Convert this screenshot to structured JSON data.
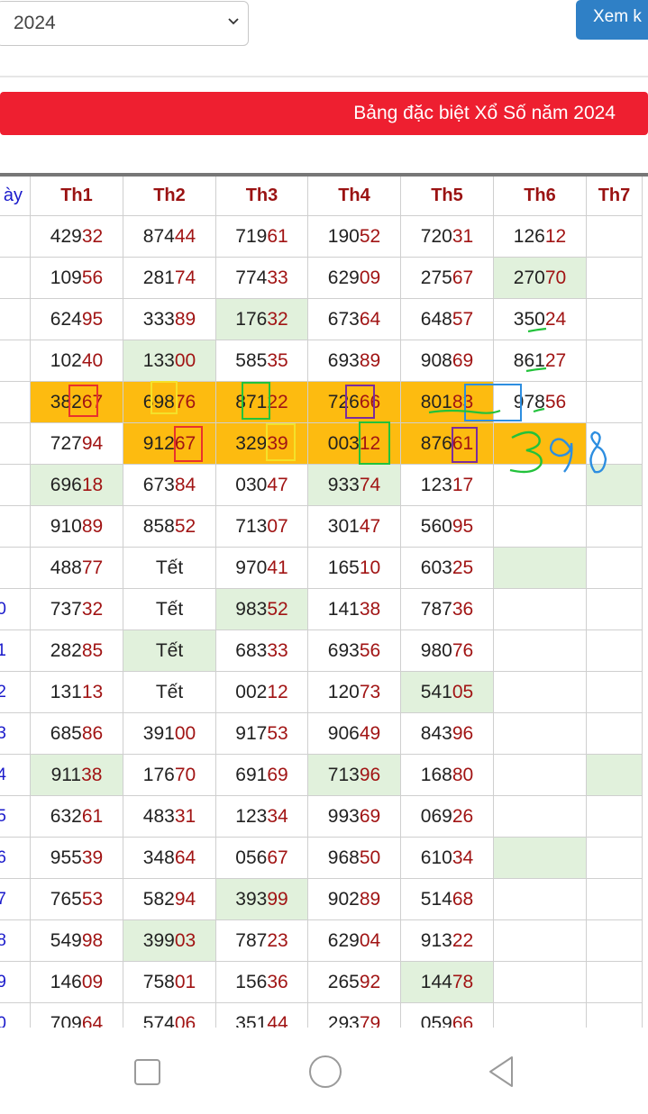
{
  "controls": {
    "year_value": "2024",
    "view_button": "Xem k"
  },
  "banner": {
    "title": "Bảng đặc biệt Xổ Số năm 2024"
  },
  "table": {
    "headers": [
      "ày",
      "Th1",
      "Th2",
      "Th3",
      "Th4",
      "Th5",
      "Th6",
      "Th7"
    ],
    "rows": [
      {
        "day": "",
        "cells": [
          "42932",
          "87444",
          "71961",
          "19052",
          "72031",
          "12612",
          ""
        ]
      },
      {
        "day": "",
        "cells": [
          "10956",
          "28174",
          "77433",
          "62909",
          "27567",
          "27070",
          ""
        ]
      },
      {
        "day": "",
        "cells": [
          "62495",
          "33389",
          "17632",
          "67364",
          "64857",
          "35024",
          ""
        ]
      },
      {
        "day": "",
        "cells": [
          "10240",
          "13300",
          "58535",
          "69389",
          "90869",
          "86127",
          ""
        ]
      },
      {
        "day": "",
        "cells": [
          "38267",
          "69876",
          "87122",
          "72666",
          "80183",
          "97856",
          ""
        ]
      },
      {
        "day": "",
        "cells": [
          "72794",
          "91267",
          "32939",
          "00312",
          "87661",
          "",
          ""
        ]
      },
      {
        "day": "",
        "cells": [
          "69618",
          "67384",
          "03047",
          "93374",
          "12317",
          "",
          ""
        ]
      },
      {
        "day": "",
        "cells": [
          "91089",
          "85852",
          "71307",
          "30147",
          "56095",
          "",
          ""
        ]
      },
      {
        "day": "",
        "cells": [
          "48877",
          "Tết",
          "97041",
          "16510",
          "60325",
          "",
          ""
        ]
      },
      {
        "day": "0",
        "cells": [
          "73732",
          "Tết",
          "98352",
          "14138",
          "78736",
          "",
          ""
        ]
      },
      {
        "day": "1",
        "cells": [
          "28285",
          "Tết",
          "68333",
          "69356",
          "98076",
          "",
          ""
        ]
      },
      {
        "day": "2",
        "cells": [
          "13113",
          "Tết",
          "00212",
          "12073",
          "54105",
          "",
          ""
        ]
      },
      {
        "day": "3",
        "cells": [
          "68586",
          "39100",
          "91753",
          "90649",
          "84396",
          "",
          ""
        ]
      },
      {
        "day": "4",
        "cells": [
          "91138",
          "17670",
          "69169",
          "71396",
          "16880",
          "",
          ""
        ]
      },
      {
        "day": "5",
        "cells": [
          "63261",
          "48331",
          "12334",
          "99369",
          "06926",
          "",
          ""
        ]
      },
      {
        "day": "6",
        "cells": [
          "95539",
          "34864",
          "05667",
          "96850",
          "61034",
          "",
          ""
        ]
      },
      {
        "day": "7",
        "cells": [
          "76553",
          "58294",
          "39399",
          "90289",
          "51468",
          "",
          ""
        ]
      },
      {
        "day": "8",
        "cells": [
          "54998",
          "39903",
          "78723",
          "62904",
          "91322",
          "",
          ""
        ]
      },
      {
        "day": "9",
        "cells": [
          "14609",
          "75801",
          "15636",
          "26592",
          "14478",
          "",
          ""
        ]
      },
      {
        "day": "0",
        "cells": [
          "70964",
          "57406",
          "35144",
          "29379",
          "05966",
          "",
          ""
        ]
      }
    ],
    "green_cells": [
      [
        1,
        5
      ],
      [
        2,
        2
      ],
      [
        3,
        1
      ],
      [
        3,
        7
      ],
      [
        6,
        0
      ],
      [
        6,
        3
      ],
      [
        6,
        6
      ],
      [
        8,
        5
      ],
      [
        9,
        2
      ],
      [
        10,
        1
      ],
      [
        10,
        7
      ],
      [
        11,
        4
      ],
      [
        13,
        0
      ],
      [
        13,
        3
      ],
      [
        13,
        6
      ],
      [
        15,
        5
      ],
      [
        16,
        2
      ],
      [
        17,
        1
      ],
      [
        17,
        7
      ],
      [
        18,
        4
      ]
    ],
    "orange_cells": [
      [
        4,
        0
      ],
      [
        4,
        1
      ],
      [
        4,
        2
      ],
      [
        4,
        3
      ],
      [
        4,
        4
      ],
      [
        5,
        1
      ],
      [
        5,
        2
      ],
      [
        5,
        3
      ],
      [
        5,
        4
      ],
      [
        5,
        5
      ]
    ]
  },
  "annotations": {
    "colors": {
      "red": "#e8322d",
      "yellow": "#f4e12a",
      "green": "#22c23b",
      "purple": "#7b2c9e",
      "blue": "#2d8ee0"
    },
    "handwriting": "398"
  },
  "nav": {
    "recent_icon": "square-icon",
    "home_icon": "circle-icon",
    "back_icon": "triangle-back-icon"
  }
}
